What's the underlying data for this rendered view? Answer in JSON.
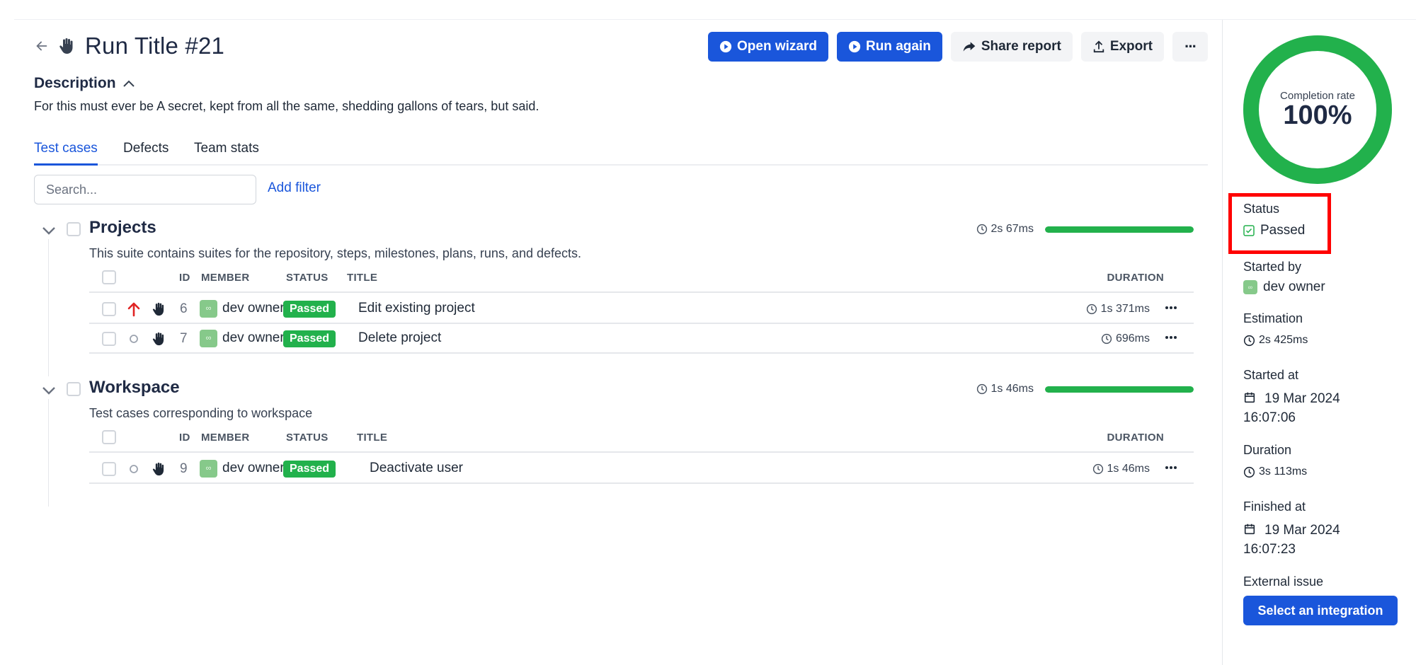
{
  "run": {
    "title": "Run Title #21",
    "description_heading": "Description",
    "description": "For this must ever be A secret, kept from all the same, shedding gallons of tears, but said."
  },
  "actions": {
    "open_wizard": "Open wizard",
    "run_again": "Run again",
    "share_report": "Share report",
    "export": "Export",
    "more": "···"
  },
  "tabs": [
    "Test cases",
    "Defects",
    "Team stats"
  ],
  "search": {
    "placeholder": "Search...",
    "add_filter": "Add filter"
  },
  "columns": {
    "id": "ID",
    "member": "MEMBER",
    "status": "STATUS",
    "title": "TITLE",
    "duration": "DURATION"
  },
  "suites": [
    {
      "name": "Projects",
      "description": "This suite contains suites for the repository, steps, milestones, plans, runs, and defects.",
      "duration": "2s 67ms",
      "progress": 1.0,
      "rows": [
        {
          "id": "6",
          "member": "dev owner",
          "status": "Passed",
          "title": "Edit existing project",
          "duration": "1s 371ms",
          "priority": "high"
        },
        {
          "id": "7",
          "member": "dev owner",
          "status": "Passed",
          "title": "Delete project",
          "duration": "696ms",
          "priority": "normal"
        }
      ]
    },
    {
      "name": "Workspace",
      "description": "Test cases corresponding to workspace",
      "duration": "1s 46ms",
      "progress": 1.0,
      "rows": [
        {
          "id": "9",
          "member": "dev owner",
          "status": "Passed",
          "title": "Deactivate user",
          "duration": "1s 46ms",
          "priority": "normal"
        }
      ]
    }
  ],
  "sidebar": {
    "completion_label": "Completion rate",
    "completion_value": "100%",
    "completion_fraction": 1.0,
    "status_label": "Status",
    "status_value": "Passed",
    "started_by_label": "Started by",
    "started_by_value": "dev owner",
    "estimation_label": "Estimation",
    "estimation_value": "2s 425ms",
    "started_at_label": "Started at",
    "started_at_date": "19 Mar 2024",
    "started_at_time": "16:07:06",
    "duration_label": "Duration",
    "duration_value": "3s 113ms",
    "finished_at_label": "Finished at",
    "finished_at_date": "19 Mar 2024",
    "finished_at_time": "16:07:23",
    "external_issue_label": "External issue",
    "integration_button": "Select an integration"
  },
  "colors": {
    "primary": "#1a56db",
    "passed": "#22b14c",
    "highlight": "#ff0000",
    "priority_high": "#e02424"
  }
}
